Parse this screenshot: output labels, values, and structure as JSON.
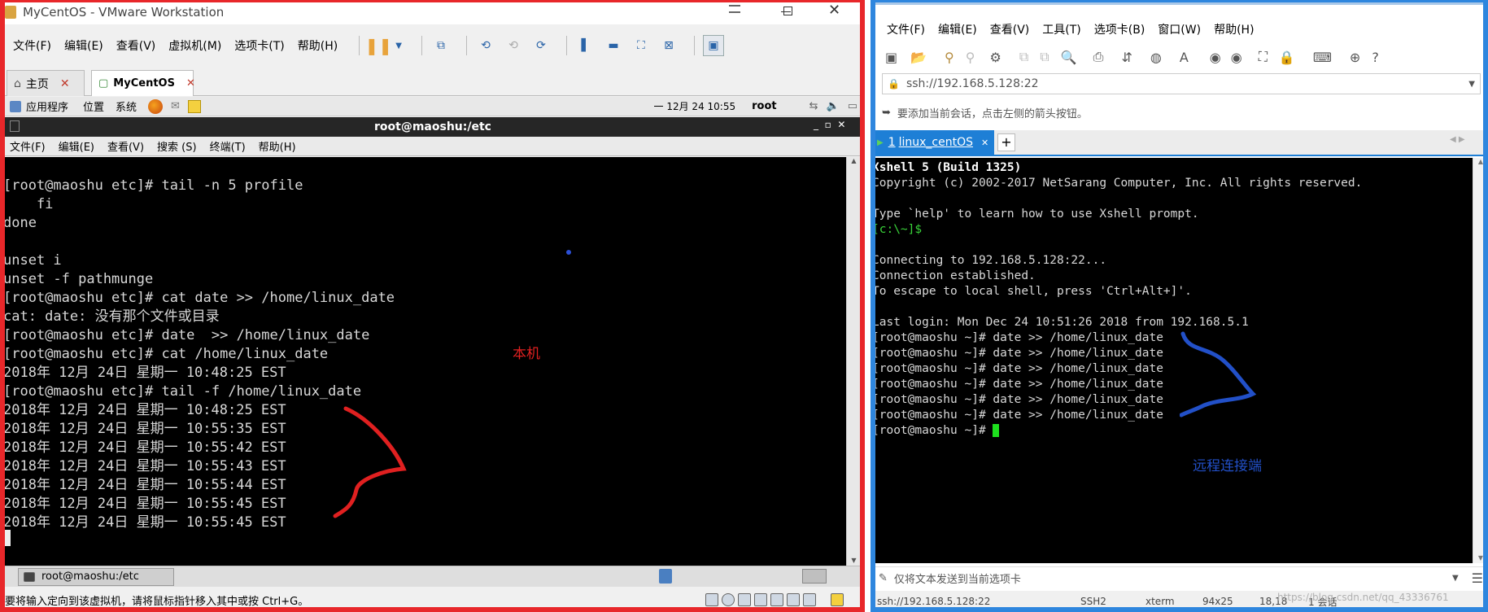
{
  "vmware": {
    "title": "MyCentOS - VMware Workstation",
    "menu": [
      "文件(F)",
      "编辑(E)",
      "查看(V)",
      "虚拟机(M)",
      "选项卡(T)",
      "帮助(H)"
    ],
    "tabs": [
      {
        "label": "主页"
      },
      {
        "label": "MyCentOS"
      }
    ],
    "gnome_panel": {
      "apps": "应用程序",
      "places": "位置",
      "system": "系统",
      "clock": "一 12月 24 10:55",
      "user": "root"
    },
    "terminal": {
      "title": "root@maoshu:/etc",
      "menu": [
        "文件(F)",
        "编辑(E)",
        "查看(V)",
        "搜索 (S)",
        "终端(T)",
        "帮助(H)"
      ],
      "lines": [
        "",
        "[root@maoshu etc]# tail -n 5 profile",
        "    fi",
        "done",
        "",
        "unset i",
        "unset -f pathmunge",
        "[root@maoshu etc]# cat date >> /home/linux_date",
        "cat: date: 没有那个文件或目录",
        "[root@maoshu etc]# date  >> /home/linux_date",
        "[root@maoshu etc]# cat /home/linux_date",
        "2018年 12月 24日 星期一 10:48:25 EST",
        "[root@maoshu etc]# tail -f /home/linux_date",
        "2018年 12月 24日 星期一 10:48:25 EST",
        "2018年 12月 24日 星期一 10:55:35 EST",
        "2018年 12月 24日 星期一 10:55:42 EST",
        "2018年 12月 24日 星期一 10:55:43 EST",
        "2018年 12月 24日 星期一 10:55:44 EST",
        "2018年 12月 24日 星期一 10:55:45 EST",
        "2018年 12月 24日 星期一 10:55:45 EST"
      ],
      "taskbar_item": "root@maoshu:/etc"
    },
    "status_hint": "要将输入定向到该虚拟机，请将鼠标指针移入其中或按 Ctrl+G。",
    "annotation": "本机"
  },
  "xshell": {
    "menu": [
      "文件(F)",
      "编辑(E)",
      "查看(V)",
      "工具(T)",
      "选项卡(B)",
      "窗口(W)",
      "帮助(H)"
    ],
    "address": "ssh://192.168.5.128:22",
    "hint": "要添加当前会话，点击左侧的箭头按钮。",
    "session_tab": {
      "num": "1",
      "label": "linux_centOS"
    },
    "lines": [
      {
        "t": "Xshell 5 (Build 1325)",
        "c": "#ffffff",
        "b": true
      },
      {
        "t": "Copyright (c) 2002-2017 NetSarang Computer, Inc. All rights reserved.",
        "c": "#d8d8d8"
      },
      {
        "t": "",
        "c": "#d8d8d8"
      },
      {
        "t": "Type `help' to learn how to use Xshell prompt.",
        "c": "#d8d8d8"
      },
      {
        "t": "[c:\\~]$",
        "c": "#39d339"
      },
      {
        "t": "",
        "c": "#d8d8d8"
      },
      {
        "t": "Connecting to 192.168.5.128:22...",
        "c": "#d8d8d8"
      },
      {
        "t": "Connection established.",
        "c": "#d8d8d8"
      },
      {
        "t": "To escape to local shell, press 'Ctrl+Alt+]'.",
        "c": "#d8d8d8"
      },
      {
        "t": "",
        "c": "#d8d8d8"
      },
      {
        "t": "Last login: Mon Dec 24 10:51:26 2018 from 192.168.5.1",
        "c": "#d8d8d8"
      },
      {
        "t": "[root@maoshu ~]# date >> /home/linux_date",
        "c": "#d8d8d8"
      },
      {
        "t": "[root@maoshu ~]# date >> /home/linux_date",
        "c": "#d8d8d8"
      },
      {
        "t": "[root@maoshu ~]# date >> /home/linux_date",
        "c": "#d8d8d8"
      },
      {
        "t": "[root@maoshu ~]# date >> /home/linux_date",
        "c": "#d8d8d8"
      },
      {
        "t": "[root@maoshu ~]# date >> /home/linux_date",
        "c": "#d8d8d8"
      },
      {
        "t": "[root@maoshu ~]# date >> /home/linux_date",
        "c": "#d8d8d8"
      },
      {
        "t": "[root@maoshu ~]# ",
        "c": "#d8d8d8"
      }
    ],
    "input_bar": "仅将文本发送到当前选项卡",
    "status": [
      "ssh://192.168.5.128:22",
      "SSH2",
      "xterm",
      "94x25",
      "18,18",
      "1 会话"
    ],
    "watermark": "https://blog.csdn.net/qq_43336761",
    "annotation": "远程连接端"
  },
  "colors": {
    "left_frame": "#e8272a",
    "right_frame": "#2e86de",
    "vmware_accent": "#e8a33b",
    "annot_red": "#e02020",
    "annot_blue": "#2250c8",
    "xshell_tab": "#1e7fd6"
  }
}
